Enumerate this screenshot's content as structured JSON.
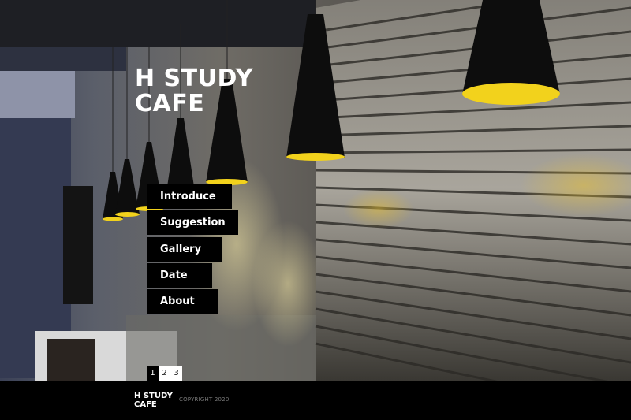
{
  "brand": {
    "line1": "H STUDY",
    "line2": "CAFE"
  },
  "menu": {
    "items": [
      {
        "label": "Introduce"
      },
      {
        "label": "Suggestion"
      },
      {
        "label": "Gallery"
      },
      {
        "label": "Date"
      },
      {
        "label": "About"
      }
    ]
  },
  "pager": {
    "pages": [
      "1",
      "2",
      "3"
    ],
    "current": "1"
  },
  "footer": {
    "logo_line1": "H STUDY",
    "logo_line2": "CAFE",
    "copyright": "COPYRIGHT 2020"
  },
  "colors": {
    "lamp_light": "#f2d21c",
    "menu_bg": "#000000",
    "footer_bg": "#000000"
  }
}
